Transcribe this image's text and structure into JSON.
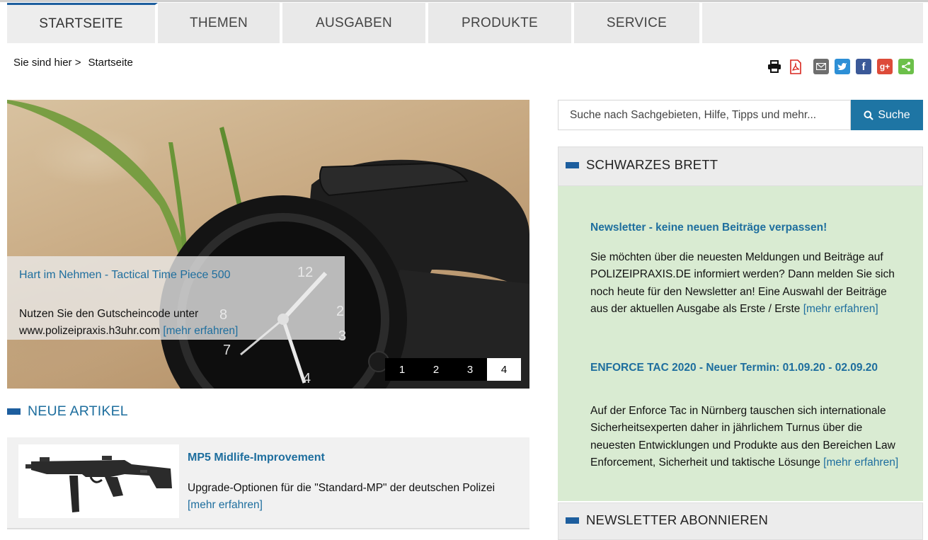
{
  "nav": {
    "items": [
      {
        "label": "STARTSEITE",
        "active": true
      },
      {
        "label": "THEMEN",
        "active": false
      },
      {
        "label": "AUSGABEN",
        "active": false
      },
      {
        "label": "PRODUKTE",
        "active": false
      },
      {
        "label": "SERVICE",
        "active": false
      }
    ]
  },
  "breadcrumb": {
    "prefix": "Sie sind hier >",
    "current": "Startseite"
  },
  "share_icons": [
    "print-icon",
    "pdf-icon",
    "email-icon",
    "twitter-icon",
    "facebook-icon",
    "google-plus-icon",
    "share-icon"
  ],
  "colors": {
    "accent": "#1d5e9e",
    "link": "#1e6e9e",
    "search_button": "#1e75a4",
    "board_bg": "#d9ebd2"
  },
  "hero": {
    "title": "Hart im Nehmen - Tactical Time Piece 500",
    "text": "Nutzen Sie den Gutscheincode unter www.polizeipraxis.h3uhr.com",
    "more": "[mehr erfahren]",
    "pager": [
      "1",
      "2",
      "3",
      "4"
    ],
    "active_page": "4"
  },
  "new_articles": {
    "heading": "NEUE ARTIKEL",
    "items": [
      {
        "title": "MP5 Midlife-Improvement",
        "text": "Upgrade-Optionen für die \"Standard-MP\" der deutschen Polizei",
        "more": "[mehr erfahren]"
      }
    ]
  },
  "search": {
    "placeholder": "Suche nach Sachgebieten, Hilfe, Tipps und mehr...",
    "button": "Suche"
  },
  "board": {
    "heading": "SCHWARZES BRETT",
    "items": [
      {
        "title": "Newsletter - keine neuen Beiträge verpassen!",
        "text": "Sie möchten über die neuesten Meldungen und Beiträge auf POLIZEIPRAXIS.DE informiert werden? Dann melden Sie sich noch heute für den Newsletter an! Eine Auswahl der Beiträge aus der aktuellen Ausgabe als Erste / Erste",
        "more": "[mehr erfahren]"
      },
      {
        "title": "ENFORCE TAC 2020 - Neuer Termin: 01.09.20 - 02.09.20",
        "text": "Auf der Enforce Tac in Nürnberg tauschen sich internationale Sicherheitsexperten daher in jährlichem Turnus über die neuesten Entwicklungen und Produkte aus den Bereichen Law Enforcement, Sicherheit und taktische Lösunge",
        "more": "[mehr erfahren]"
      }
    ]
  },
  "newsletter": {
    "heading": "NEWSLETTER ABONNIEREN"
  }
}
